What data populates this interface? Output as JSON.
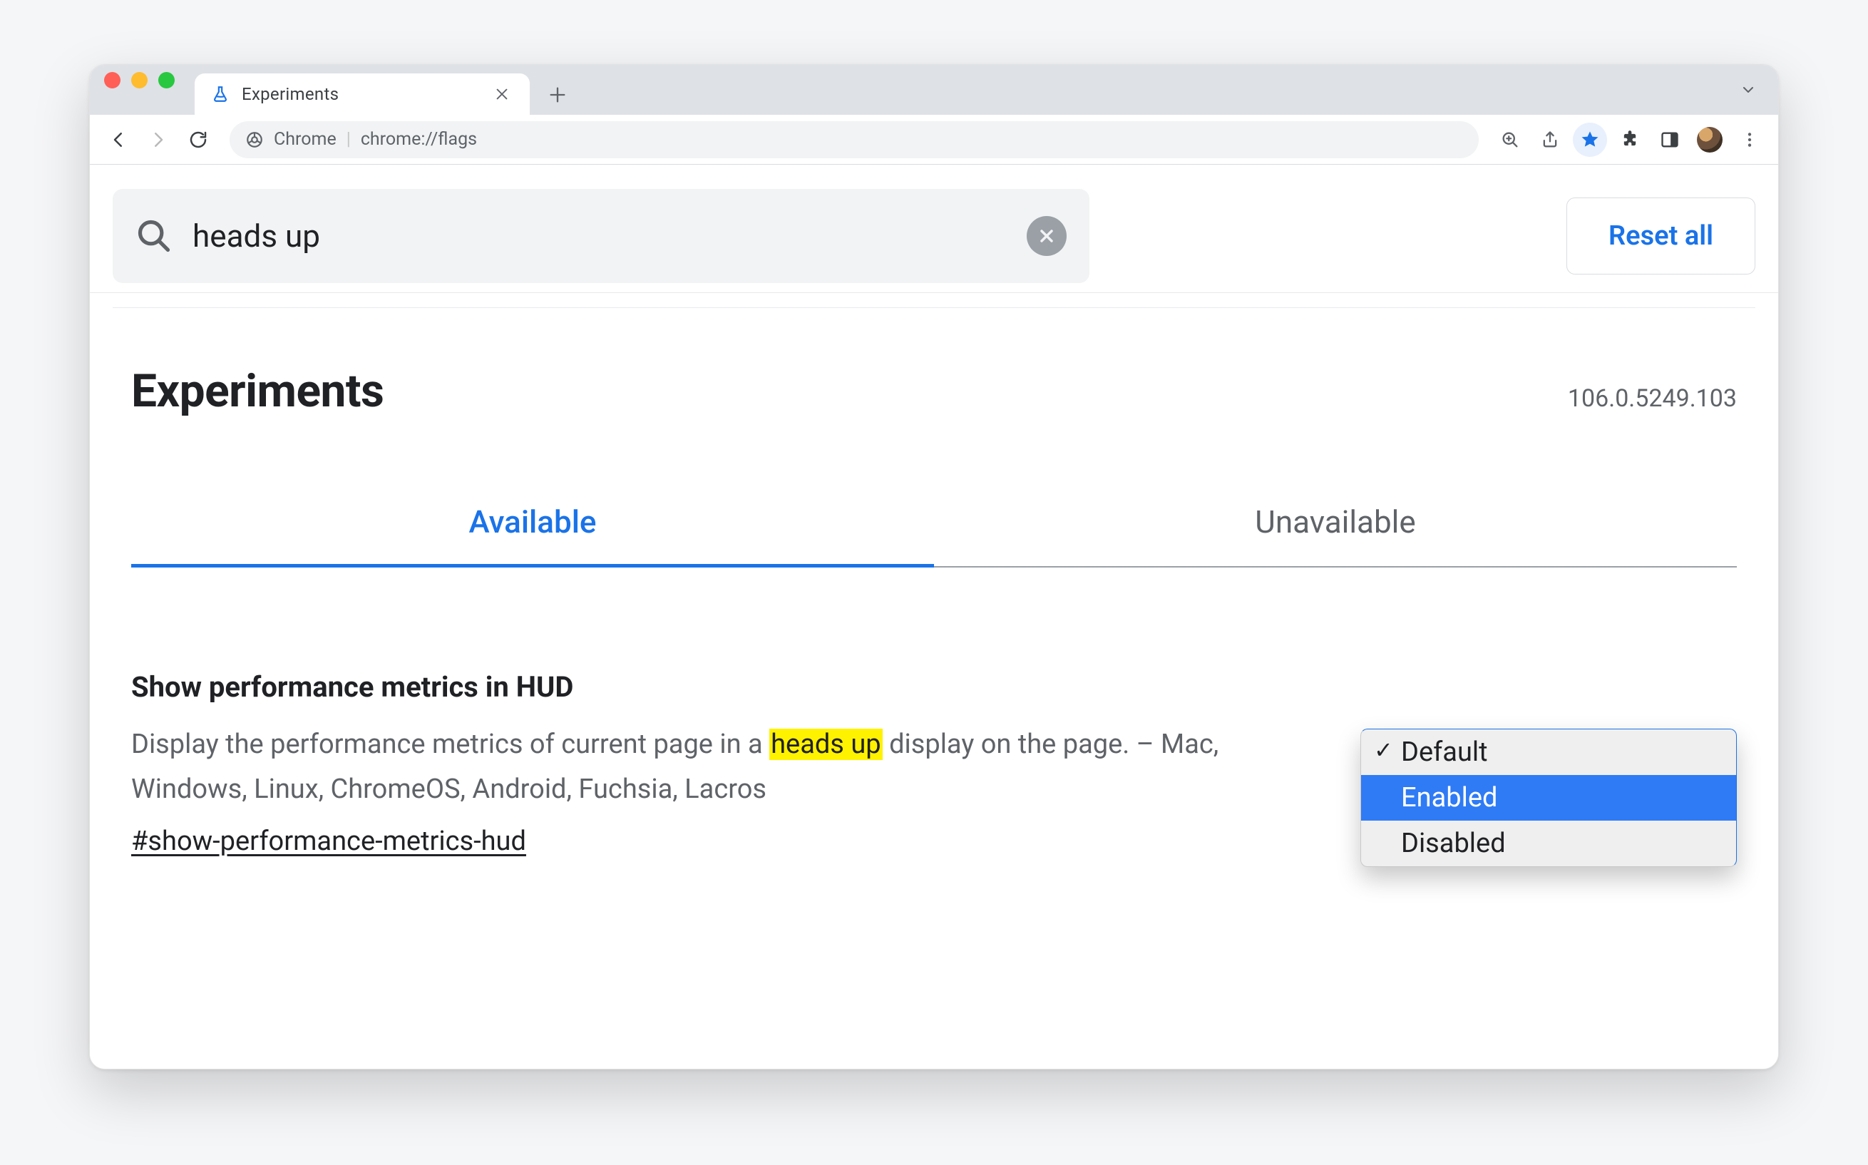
{
  "browser": {
    "tab_title": "Experiments",
    "omnibox_origin": "Chrome",
    "omnibox_path": "chrome://flags",
    "icons": {
      "back": "back-icon",
      "forward": "forward-icon",
      "reload": "reload-icon",
      "zoom": "zoom-icon",
      "share": "share-icon",
      "bookmark": "bookmark-star-icon",
      "extensions": "puzzle-piece-icon",
      "sidepanel": "side-panel-icon",
      "profile": "profile-avatar",
      "overflow": "kebab-icon",
      "tabs_menu": "chevron-down-icon",
      "chrome_logo": "chrome-logo-icon",
      "close_tab": "close-icon",
      "new_tab": "plus-icon",
      "favicon": "flask-icon"
    }
  },
  "page": {
    "search_value": "heads up",
    "reset_button": "Reset all",
    "title": "Experiments",
    "version": "106.0.5249.103",
    "tabs": [
      {
        "label": "Available",
        "active": true
      },
      {
        "label": "Unavailable",
        "active": false
      }
    ],
    "flag": {
      "title": "Show performance metrics in HUD",
      "desc_before": "Display the performance metrics of current page in a ",
      "desc_highlight": "heads up",
      "desc_after": " display on the page. – Mac, Windows, Linux, ChromeOS, Android, Fuchsia, Lacros",
      "link": "#show-performance-metrics-hud",
      "options": [
        {
          "label": "Default",
          "selected": true,
          "highlighted": false
        },
        {
          "label": "Enabled",
          "selected": false,
          "highlighted": true
        },
        {
          "label": "Disabled",
          "selected": false,
          "highlighted": false
        }
      ]
    }
  }
}
